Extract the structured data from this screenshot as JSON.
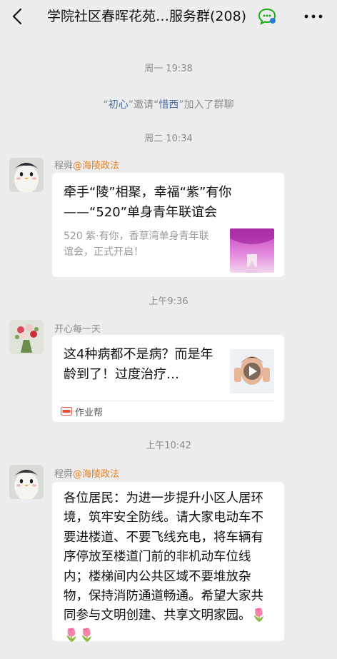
{
  "header": {
    "title": "学院社区春晖花苑…服务群(208)",
    "back_icon": "chevron-left-icon",
    "chat_icon": "group-chat-icon",
    "more_icon": "more-dots-icon"
  },
  "messages": {
    "ts1": "周一 19:38",
    "sys1": {
      "name1": "初心",
      "mid": "邀请",
      "name2": "惜西",
      "tail": "加入了群聊"
    },
    "ts2": "周二 10:34",
    "msg1": {
      "sender_name": "程舜",
      "sender_tag": "@海陵政法",
      "title": "牵手“陵”相聚，幸福“紫”有你——“520”单身青年联谊会",
      "desc": "520 紫·有你，香草湾单身青年联谊会，正式开启！"
    },
    "ts3": "上午9:36",
    "msg2": {
      "sender_name": "开心每一天",
      "title": "这4种病都不是病？而是年龄到了！过度治疗…",
      "source_name": "作业帮"
    },
    "ts4": "上午10:42",
    "msg3": {
      "sender_name": "程舜",
      "sender_tag": "@海陵政法",
      "text": "各位居民：为进一步提升小区人居环境，筑牢安全防线。请大家电动车不要进楼道、不要飞线充电，将车辆有序停放至楼道门前的非机动车位线内；楼梯间内公共区域不要堆放杂物，保持消防通道畅通。希望大家共同参与文明创建、共享文明家园。",
      "emojis": "🌷🌷🌷"
    }
  },
  "colors": {
    "background": "#ededed",
    "link_blue": "#4a6aa5",
    "tag_orange": "#e67e22",
    "meta_gray": "#8a8a8a"
  }
}
